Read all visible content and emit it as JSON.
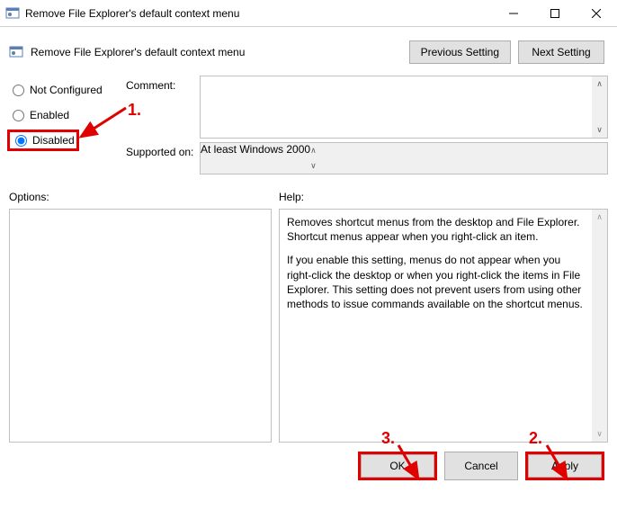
{
  "window": {
    "title": "Remove File Explorer's default context menu",
    "minimize": "—",
    "maximize": "☐",
    "close": "✕"
  },
  "header": {
    "title": "Remove File Explorer's default context menu",
    "prev": "Previous Setting",
    "next": "Next Setting"
  },
  "radios": {
    "not_configured": "Not Configured",
    "enabled": "Enabled",
    "disabled": "Disabled"
  },
  "labels": {
    "comment": "Comment:",
    "supported": "Supported on:",
    "options": "Options:",
    "help": "Help:"
  },
  "fields": {
    "comment_value": "",
    "supported_value": "At least Windows 2000"
  },
  "help": {
    "p1": "Removes shortcut menus from the desktop and File Explorer. Shortcut menus appear when you right-click an item.",
    "p2": "If you enable this setting, menus do not appear when you right-click the desktop or when you right-click the items in File Explorer. This setting does not prevent users from using other methods to issue commands available on the shortcut menus."
  },
  "footer": {
    "ok": "OK",
    "cancel": "Cancel",
    "apply": "Apply"
  },
  "annotations": {
    "n1": "1.",
    "n2": "2.",
    "n3": "3."
  }
}
